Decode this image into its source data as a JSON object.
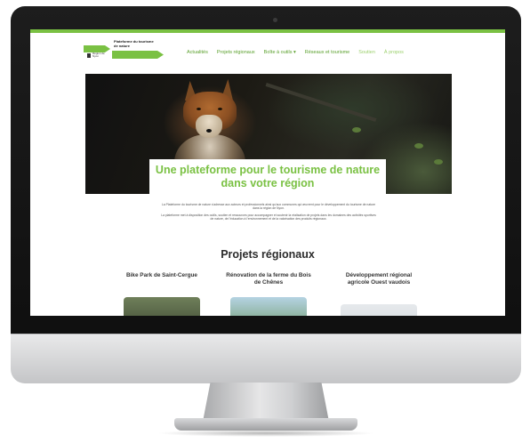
{
  "site": {
    "logo": {
      "title": "Plateforme du tourisme de nature",
      "subtitle": "Région de Nyon"
    },
    "nav": [
      "Actualités",
      "Projets régionaux",
      "Boîte à outils ▾",
      "Réseaux et tourisme",
      "Soutien",
      "À propos"
    ],
    "hero": {
      "title": "Une plateforme pour le tourisme de nature dans votre région"
    },
    "intro": [
      "La Plateforme du tourisme de nature s'adresse aux acteurs et professionnels ainsi qu'aux communes qui œuvrent pour le développement du tourisme de nature dans la région de Nyon.",
      "La plateforme met à disposition des outils, soutien et ressources pour accompagner et soutenir la réalisation de projets dans les domaines des activités sportives de nature, de l'éducation à l'environnement et de la valorisation des produits régionaux."
    ],
    "section_title": "Projets régionaux",
    "projects": [
      "Bike Park de Saint-Cergue",
      "Rénovation de la ferme du Bois de Chênes",
      "Développement régional agricole Ouest vaudois"
    ]
  },
  "colors": {
    "brand_green": "#7ac143",
    "nav_green": "#5aa02c",
    "bezel": "#111111",
    "aluminum": "#d4d5d7"
  }
}
